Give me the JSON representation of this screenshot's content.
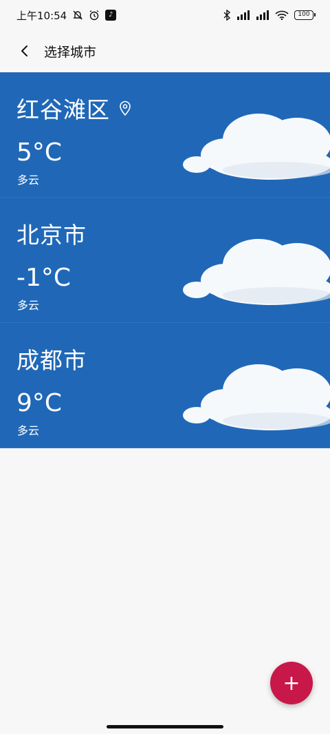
{
  "status_bar": {
    "time": "上午10:54",
    "tiktok_glyph": "♪",
    "battery": "100",
    "icons": [
      "mute-icon",
      "alarm-icon",
      "tiktok-icon",
      "bluetooth-icon",
      "signal-icon",
      "signal-icon",
      "wifi-icon",
      "battery-icon"
    ]
  },
  "header": {
    "title": "选择城市",
    "back_icon": "chevron-left-icon"
  },
  "cities": [
    {
      "name": "红谷滩区",
      "temp": "5°C",
      "condition": "多云",
      "located": true
    },
    {
      "name": "北京市",
      "temp": "-1°C",
      "condition": "多云",
      "located": false
    },
    {
      "name": "成都市",
      "temp": "9°C",
      "condition": "多云",
      "located": false
    }
  ],
  "fab": {
    "label": "+"
  },
  "colors": {
    "card_bg": "#2068b7",
    "fab_bg": "#c8184a",
    "page_bg": "#f7f7f7"
  }
}
